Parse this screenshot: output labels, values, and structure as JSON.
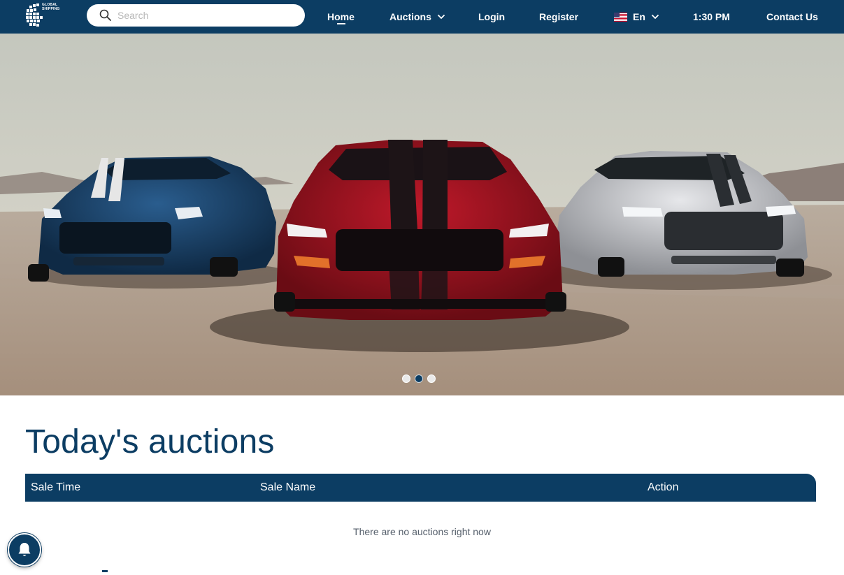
{
  "colors": {
    "primary": "#0c3d63",
    "text_muted": "#555f6b",
    "white": "#ffffff"
  },
  "logo": {
    "icon": "globe-logo-icon",
    "text_line1": "GLOBAL",
    "text_line2": "SHIPPING"
  },
  "search": {
    "placeholder": "Search",
    "value": "",
    "icon": "search-icon"
  },
  "nav": {
    "home": "Home",
    "auctions": "Auctions",
    "login": "Login",
    "register": "Register",
    "language": "En",
    "time": "1:30 PM",
    "contact": "Contact Us"
  },
  "hero": {
    "image": "three sports cars on desert road",
    "slides": [
      {
        "active": false
      },
      {
        "active": true
      },
      {
        "active": false
      }
    ]
  },
  "auctions": {
    "title": "Today's auctions",
    "columns": [
      "Sale Time",
      "Sale Name",
      "Action"
    ],
    "rows": [],
    "empty_message": "There are no auctions right now"
  },
  "notification": {
    "icon": "bell-icon"
  }
}
